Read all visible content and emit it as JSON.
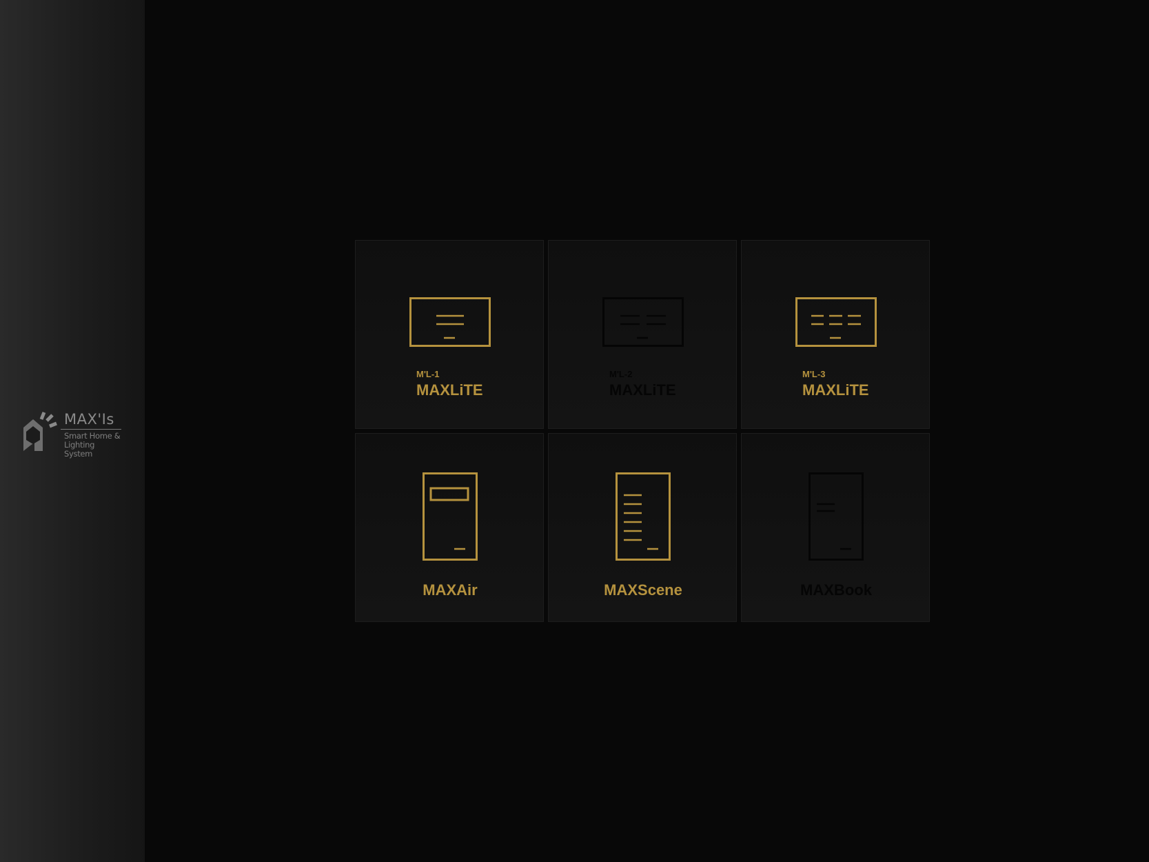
{
  "logo": {
    "title": "MAX'Is",
    "subtitle_line1": "Smart Home &",
    "subtitle_line2": "Lighting System"
  },
  "colors": {
    "accent_gold": "#b5923e",
    "disabled": "#050505",
    "background": "#080808"
  },
  "tiles": [
    {
      "code": "M'L-1",
      "name": "MAXLiTE",
      "icon": "lighting-panel-1-icon",
      "enabled": true
    },
    {
      "code": "M'L-2",
      "name": "MAXLiTE",
      "icon": "lighting-panel-2-icon",
      "enabled": false
    },
    {
      "code": "M'L-3",
      "name": "MAXLiTE",
      "icon": "lighting-panel-3-icon",
      "enabled": true
    },
    {
      "code": "",
      "name": "MAXAir",
      "icon": "air-control-panel-icon",
      "enabled": true
    },
    {
      "code": "",
      "name": "MAXScene",
      "icon": "scene-panel-icon",
      "enabled": true
    },
    {
      "code": "",
      "name": "MAXBook",
      "icon": "book-panel-icon",
      "enabled": false
    }
  ]
}
